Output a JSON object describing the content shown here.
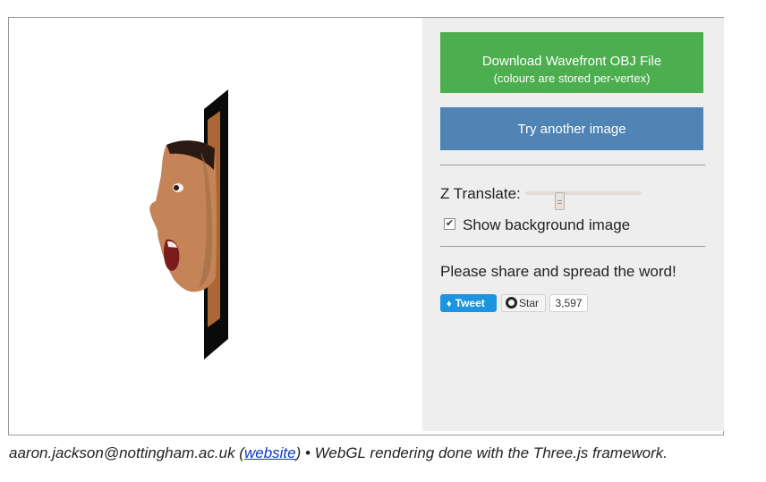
{
  "panel": {
    "download": {
      "title": "Download Wavefront OBJ File",
      "subtitle": "(colours are stored per-vertex)"
    },
    "try_another": "Try another image",
    "z_translate": {
      "label": "Z Translate:",
      "value_fraction": 0.28
    },
    "show_background": {
      "label": "Show background image",
      "checked": true,
      "check_glyph": "✔"
    },
    "share_text": "Please share and spread the word!",
    "social": {
      "tweet_label": "Tweet",
      "star_label": "Star",
      "star_count": "3,597"
    }
  },
  "footer": {
    "email": "aaron.jackson@nottingham.ac.uk",
    "open_paren": " (",
    "website_label": "website",
    "rest": ") • WebGL rendering done with the Three.js framework."
  },
  "colors": {
    "download_button": "#4cae4f",
    "try_button": "#4f84b4",
    "panel_bg": "#eeeeee",
    "tweet_button": "#1b95e0",
    "link": "#0b38c8"
  }
}
